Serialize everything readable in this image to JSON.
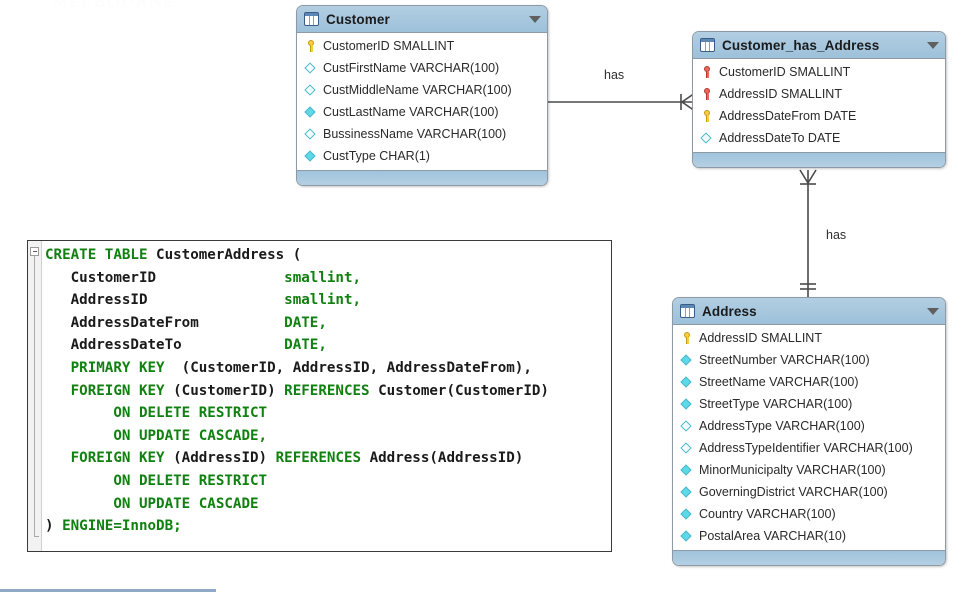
{
  "watermark": "MELBOURNE",
  "diagram": {
    "type": "entity-relationship-diagram",
    "tables": [
      {
        "id": "customer",
        "name": "Customer",
        "icon": "table-icon",
        "caret": "chevron-down-icon",
        "columns": [
          {
            "label": "CustomerID SMALLINT",
            "marker": "key-yellow"
          },
          {
            "label": "CustFirstName VARCHAR(100)",
            "marker": "diamond-hollow"
          },
          {
            "label": "CustMiddleName VARCHAR(100)",
            "marker": "diamond-hollow"
          },
          {
            "label": "CustLastName VARCHAR(100)",
            "marker": "diamond-filled"
          },
          {
            "label": "BussinessName VARCHAR(100)",
            "marker": "diamond-hollow"
          },
          {
            "label": "CustType CHAR(1)",
            "marker": "diamond-filled"
          }
        ]
      },
      {
        "id": "customer_has_address",
        "name": "Customer_has_Address",
        "icon": "table-icon",
        "caret": "chevron-down-icon",
        "columns": [
          {
            "label": "CustomerID SMALLINT",
            "marker": "key-red"
          },
          {
            "label": "AddressID SMALLINT",
            "marker": "key-red"
          },
          {
            "label": "AddressDateFrom DATE",
            "marker": "key-yellow"
          },
          {
            "label": "AddressDateTo DATE",
            "marker": "diamond-hollow"
          }
        ]
      },
      {
        "id": "address",
        "name": "Address",
        "icon": "table-icon",
        "caret": "chevron-down-icon",
        "columns": [
          {
            "label": "AddressID SMALLINT",
            "marker": "key-yellow"
          },
          {
            "label": "StreetNumber VARCHAR(100)",
            "marker": "diamond-filled"
          },
          {
            "label": "StreetName VARCHAR(100)",
            "marker": "diamond-filled"
          },
          {
            "label": "StreetType VARCHAR(100)",
            "marker": "diamond-filled"
          },
          {
            "label": "AddressType VARCHAR(100)",
            "marker": "diamond-hollow"
          },
          {
            "label": "AddressTypeIdentifier VARCHAR(100)",
            "marker": "diamond-hollow"
          },
          {
            "label": "MinorMunicipalty VARCHAR(100)",
            "marker": "diamond-filled"
          },
          {
            "label": "GoverningDistrict VARCHAR(100)",
            "marker": "diamond-filled"
          },
          {
            "label": "Country VARCHAR(100)",
            "marker": "diamond-filled"
          },
          {
            "label": "PostalArea VARCHAR(10)",
            "marker": "diamond-filled"
          }
        ]
      }
    ],
    "relationships": [
      {
        "id": "rel-customer-cha",
        "label": "has",
        "from": "Customer",
        "to": "Customer_has_Address",
        "from_notation": "one-mandatory",
        "to_notation": "many"
      },
      {
        "id": "rel-cha-address",
        "label": "has",
        "from": "Customer_has_Address",
        "to": "Address",
        "from_notation": "many",
        "to_notation": "one-mandatory"
      }
    ],
    "colors": {
      "header": "#a8c8de",
      "border": "#8d9aa6",
      "key_primary": "#f5cf3e",
      "key_foreign": "#e8695c",
      "column_diamond": "#5fd8e8",
      "line": "#4a4a4a",
      "sql_keyword": "#108010",
      "rule": "#8fa9c6"
    }
  },
  "sql": {
    "title": "CREATE TABLE CustomerAddress",
    "lines": [
      [
        [
          "kw",
          "CREATE TABLE "
        ],
        [
          "id",
          "CustomerAddress ("
        ]
      ],
      [
        [
          "id",
          "   CustomerID               "
        ],
        [
          "kw",
          "smallint,"
        ]
      ],
      [
        [
          "id",
          "   AddressID                "
        ],
        [
          "kw",
          "smallint,"
        ]
      ],
      [
        [
          "id",
          "   AddressDateFrom          "
        ],
        [
          "kw",
          "DATE,"
        ]
      ],
      [
        [
          "id",
          "   AddressDateTo            "
        ],
        [
          "kw",
          "DATE,"
        ]
      ],
      [
        [
          "kw",
          "   PRIMARY KEY "
        ],
        [
          "id",
          " (CustomerID, AddressID, AddressDateFrom),"
        ]
      ],
      [
        [
          "kw",
          "   FOREIGN KEY "
        ],
        [
          "id",
          "(CustomerID) "
        ],
        [
          "kw",
          "REFERENCES "
        ],
        [
          "id",
          "Customer(CustomerID)"
        ]
      ],
      [
        [
          "kw",
          "        ON DELETE RESTRICT"
        ]
      ],
      [
        [
          "kw",
          "        ON UPDATE CASCADE,"
        ]
      ],
      [
        [
          "kw",
          "   FOREIGN KEY "
        ],
        [
          "id",
          "(AddressID) "
        ],
        [
          "kw",
          "REFERENCES "
        ],
        [
          "id",
          "Address(AddressID)"
        ]
      ],
      [
        [
          "kw",
          "        ON DELETE RESTRICT"
        ]
      ],
      [
        [
          "kw",
          "        ON UPDATE CASCADE"
        ]
      ],
      [
        [
          "id",
          ") "
        ],
        [
          "kw",
          "ENGINE=InnoDB;"
        ]
      ]
    ]
  }
}
